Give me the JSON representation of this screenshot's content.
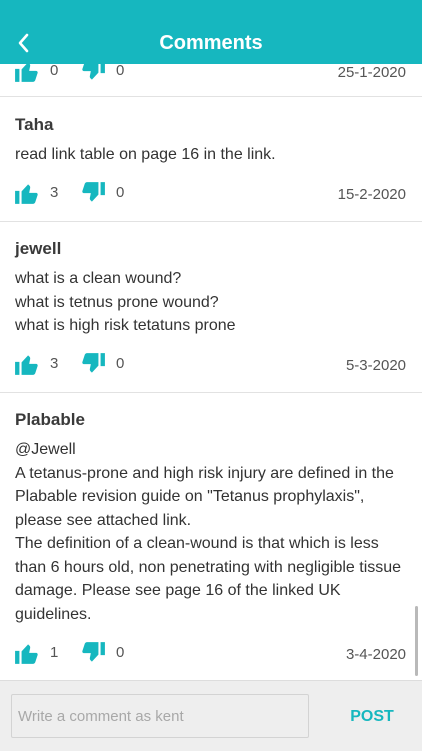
{
  "header": {
    "title": "Comments"
  },
  "comments": [
    {
      "author": "",
      "text": "",
      "likes": "0",
      "dislikes": "0",
      "date": "25-1-2020"
    },
    {
      "author": "Taha",
      "text": "read link table on page 16 in the link.",
      "likes": "3",
      "dislikes": "0",
      "date": "15-2-2020"
    },
    {
      "author": "jewell",
      "text": "what is a clean wound?\nwhat is tetnus prone wound?\nwhat is high risk tetatuns prone",
      "likes": "3",
      "dislikes": "0",
      "date": "5-3-2020"
    },
    {
      "author": "Plabable",
      "text": "@Jewell\nA tetanus-prone and high risk injury are defined in the Plabable revision guide on \"Tetanus prophylaxis\", please see attached link.\nThe definition of a clean-wound is that which is less than 6 hours old, non penetrating with negligible tissue damage. Please see page 16 of the linked UK guidelines.",
      "likes": "1",
      "dislikes": "0",
      "date": "3-4-2020"
    }
  ],
  "composer": {
    "placeholder": "Write a comment as kent",
    "post_label": "POST"
  },
  "colors": {
    "accent": "#16b7bf"
  },
  "icons": {
    "back": "chevron-left-icon",
    "like": "thumbs-up-icon",
    "dislike": "thumbs-down-icon"
  }
}
